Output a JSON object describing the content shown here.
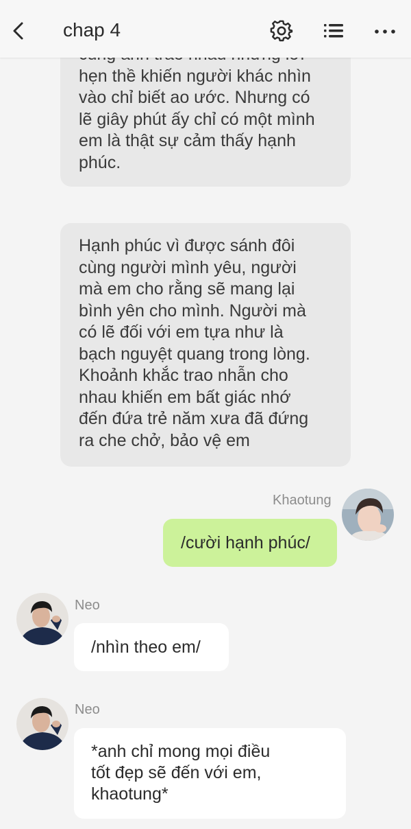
{
  "header": {
    "title": "chap 4",
    "icons": [
      "back-icon",
      "settings-icon",
      "list-icon",
      "more-icon"
    ]
  },
  "narration": [
    {
      "lines": [
        "cùng anh trao nhau những lời",
        "hẹn thề khiến người khác nhìn",
        "vào chỉ biết ao ước. Nhưng có",
        "lẽ giây phút ấy chỉ có một mình",
        "em là thật sự cảm thấy hạnh",
        "phúc."
      ]
    },
    {
      "lines": [
        "Hạnh phúc vì được sánh đôi",
        "cùng người mình yêu, người",
        "mà em cho rằng sẽ mang lại",
        "bình yên cho mình. Người mà",
        "có lẽ đối với em tựa như là",
        "bạch nguyệt quang trong lòng.",
        "Khoảnh khắc trao nhẫn cho",
        "nhau khiến em bất giác nhớ",
        "đến đứa trẻ năm xưa đã đứng",
        "ra che chở, bảo vệ em"
      ]
    }
  ],
  "messages": [
    {
      "sender": "Khaotung",
      "side": "right",
      "lines": [
        "/cười hạnh phúc/"
      ]
    },
    {
      "sender": "Neo",
      "side": "left",
      "lines": [
        "/nhìn theo em/"
      ]
    },
    {
      "sender": "Neo",
      "side": "left",
      "lines": [
        "*anh chỉ mong mọi điều",
        "tốt đẹp sẽ đến với em,",
        "khaotung*"
      ]
    }
  ],
  "colors": {
    "background": "#f4f4f4",
    "narration_bubble": "#e8e8e8",
    "right_bubble": "#ccf29a",
    "left_bubble": "#ffffff"
  }
}
